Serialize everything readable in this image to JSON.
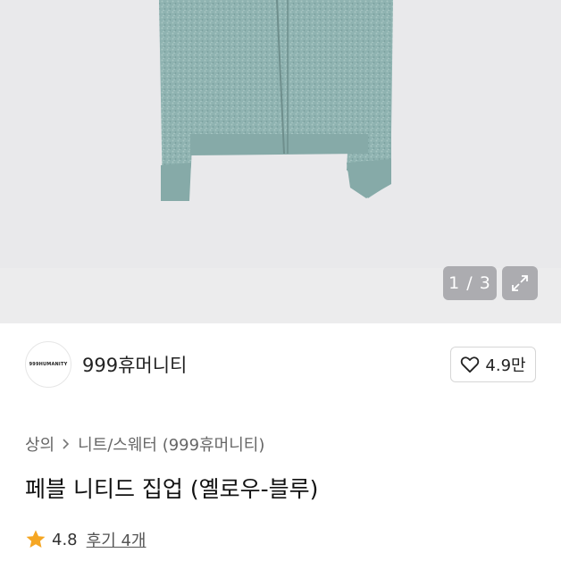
{
  "image_pager": {
    "current": "1",
    "separator": "/",
    "total": "3",
    "text": "1 / 3"
  },
  "shop": {
    "name": "999휴머니티",
    "logo_text": "999HUMANITY",
    "likes": "4.9만"
  },
  "breadcrumb": {
    "category": "상의",
    "subcategory": "니트/스웨터 (999휴머니티)"
  },
  "product": {
    "title": "페블 니티드 집업 (옐로우-블루)"
  },
  "rating": {
    "score": "4.8",
    "reviews": "후기 4개"
  },
  "colors": {
    "sweater": "#8fb3b1",
    "star": "#f5a623",
    "hero_bg": "#e9e9eb"
  }
}
